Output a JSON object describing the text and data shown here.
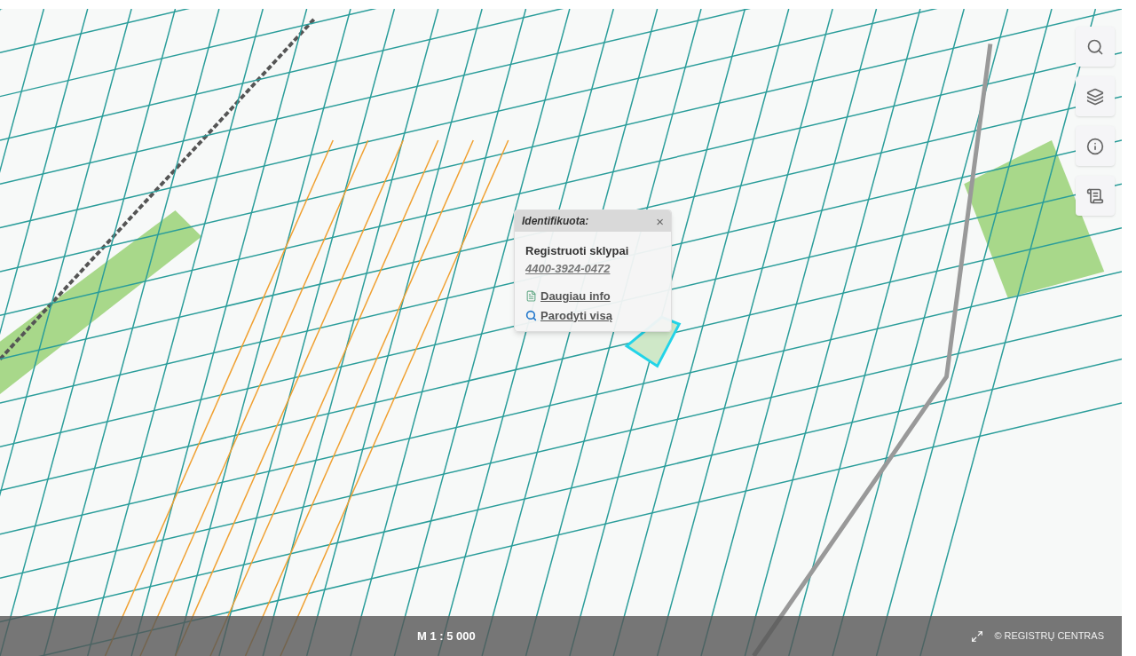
{
  "popup": {
    "title": "Identifikuota:",
    "close": "×",
    "heading": "Registruoti sklypai",
    "parcel_link": "4400-3924-0472",
    "links": [
      {
        "kind": "info",
        "label": "Daugiau info"
      },
      {
        "kind": "zoom",
        "label": "Parodyti visą"
      }
    ]
  },
  "toolbar": [
    {
      "kind": "search"
    },
    {
      "kind": "layers"
    },
    {
      "kind": "info"
    },
    {
      "kind": "legend"
    }
  ],
  "status_bar": {
    "scale": "M 1 : 5 000",
    "attribution": "© REGISTRŲ CENTRAS"
  }
}
